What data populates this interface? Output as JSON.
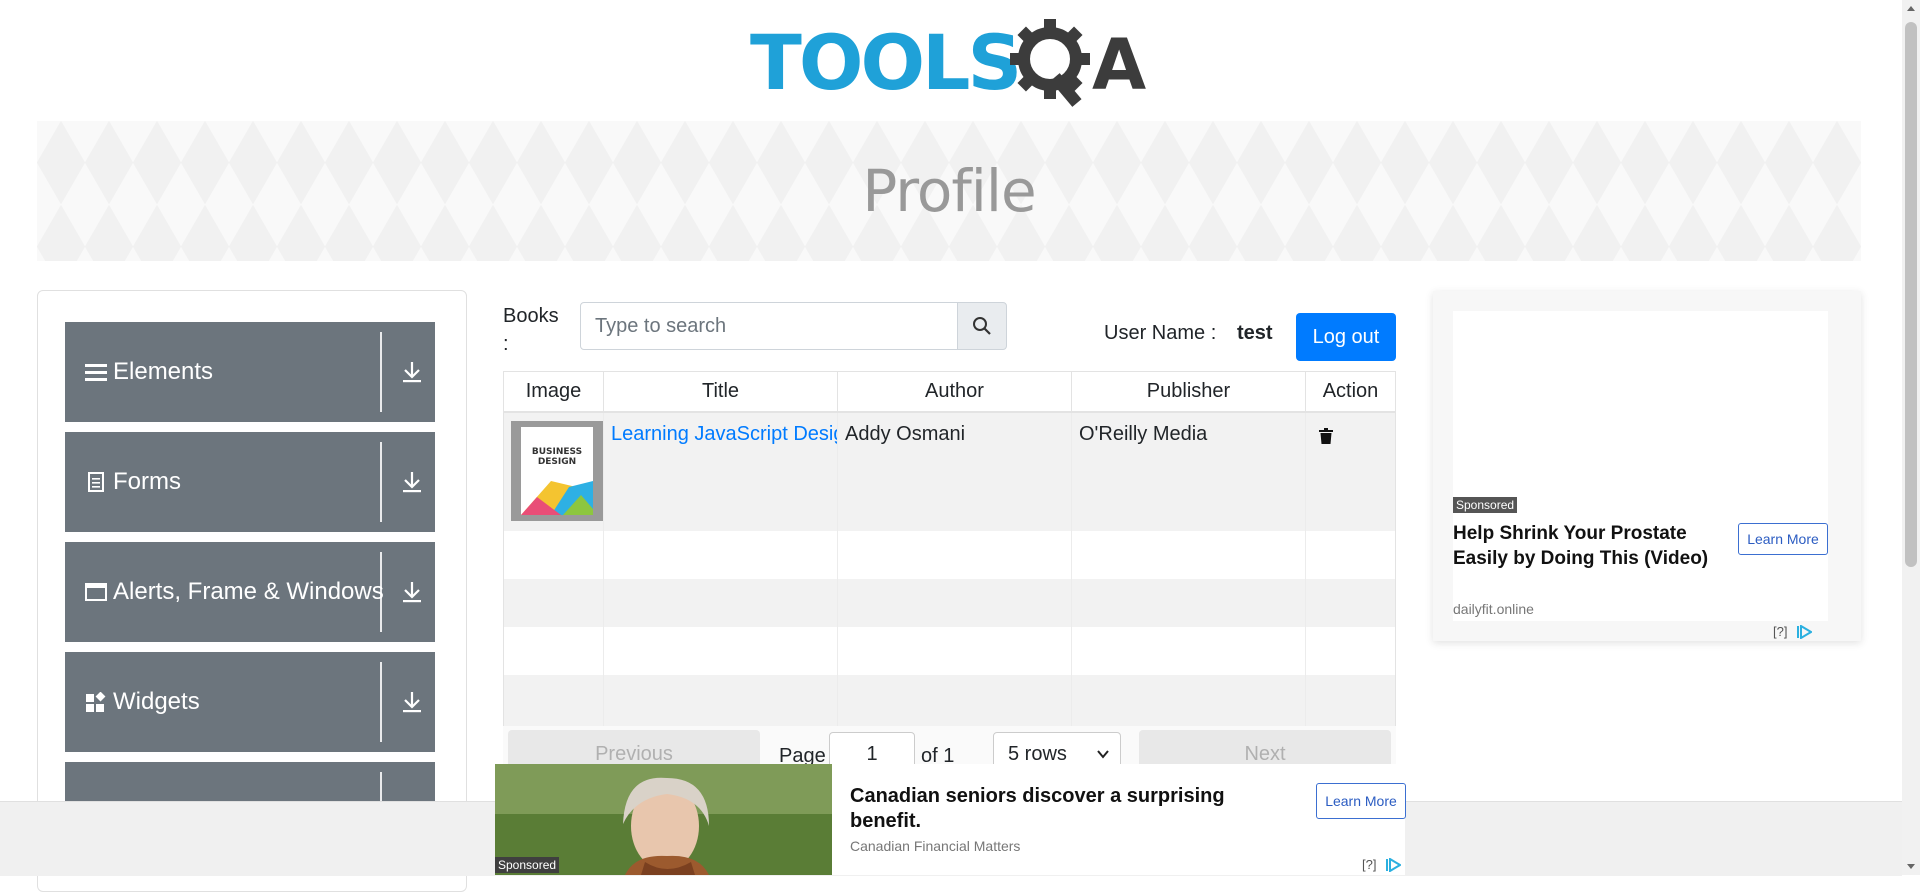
{
  "header": {
    "logo_text": "TOOLSQA",
    "page_title": "Profile"
  },
  "sidebar": {
    "groups": [
      {
        "label": "Elements",
        "icon": "list-icon"
      },
      {
        "label": "Forms",
        "icon": "form-icon"
      },
      {
        "label": "Alerts, Frame & Windows",
        "icon": "window-icon"
      },
      {
        "label": "Widgets",
        "icon": "widgets-icon"
      },
      {
        "label": "",
        "icon": ""
      }
    ]
  },
  "books": {
    "label": "Books :",
    "search_placeholder": "Type to search",
    "user_label": "User Name :",
    "user_name": "test",
    "logout_label": "Log out",
    "columns": [
      "Image",
      "Title",
      "Author",
      "Publisher",
      "Action"
    ],
    "rows": [
      {
        "title": "Learning JavaScript Design Patterns",
        "author": "Addy Osmani",
        "publisher": "O'Reilly Media",
        "cover_text": [
          "BUSINESS",
          "DESIGN"
        ]
      }
    ],
    "pagination": {
      "previous_label": "Previous",
      "page_label": "Page",
      "page_value": "1",
      "of_label": "of 1",
      "rows_option": "5 rows",
      "next_label": "Next"
    }
  },
  "side_ad": {
    "sponsored": "Sponsored",
    "title": "Help Shrink Your Prostate Easily by Doing This (Video)",
    "source": "dailyfit.online",
    "cta": "Learn More",
    "choices": "[?]"
  },
  "bottom_ad": {
    "sponsored": "Sponsored",
    "title": "Canadian seniors discover a surprising benefit.",
    "source": "Canadian Financial Matters",
    "cta": "Learn More",
    "choices": "[?]"
  },
  "colors": {
    "primary": "#007bff",
    "menu_bg": "#6c757d",
    "logo_blue": "#1fa1d8",
    "logo_dark": "#3c3c3c"
  }
}
